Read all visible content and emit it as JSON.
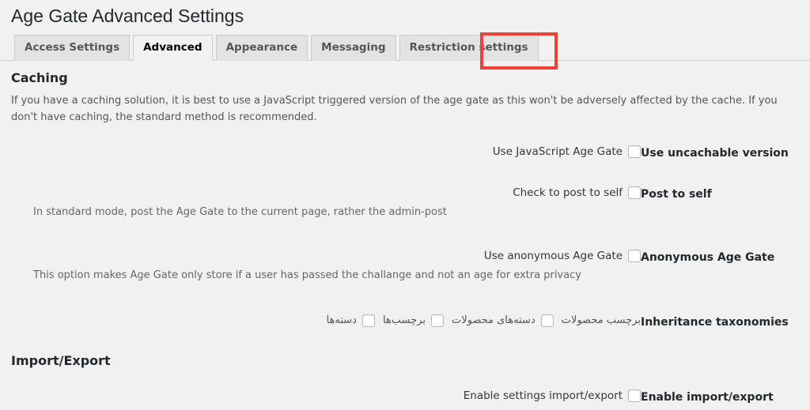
{
  "header": {
    "title": "Age Gate Advanced Settings"
  },
  "tabs": [
    {
      "label": "Access Settings",
      "name": "tab-access-settings",
      "active": false
    },
    {
      "label": "Advanced",
      "name": "tab-advanced",
      "active": true
    },
    {
      "label": "Appearance",
      "name": "tab-appearance",
      "active": false
    },
    {
      "label": "Messaging",
      "name": "tab-messaging",
      "active": false
    },
    {
      "label": "Restriction settings",
      "name": "tab-restriction-settings",
      "active": false
    }
  ],
  "highlight": {
    "color": "#ef4136",
    "target": "Advanced"
  },
  "sections": {
    "caching": {
      "heading": "Caching",
      "description": "If you have a caching solution, it is best to use a JavaScript triggered version of the age gate as this won't be adversely affected by the cache. If you don't have caching, the standard method is recommended."
    },
    "import_export": {
      "heading": "Import/Export"
    }
  },
  "rows": {
    "uncachable": {
      "label": "Use uncachable version",
      "checkbox_text": "Use JavaScript Age Gate",
      "checked": false
    },
    "post_to_self": {
      "label": "Post to self",
      "checkbox_text": "Check to post to self",
      "checked": false,
      "description": "In standard mode, post the Age Gate to the current page, rather the admin-post"
    },
    "anonymous": {
      "label": "Anonymous Age Gate",
      "checkbox_text": "Use anonymous Age Gate",
      "checked": false,
      "description": "This option makes Age Gate only store if a user has passed the challange and not an age for extra privacy"
    },
    "taxonomies": {
      "label": "Inheritance taxonomies",
      "items": [
        {
          "text": "دسته‌ها",
          "checked": false
        },
        {
          "text": "برچسب‌ها",
          "checked": false
        },
        {
          "text": "دسته‌های محصولات",
          "checked": false
        },
        {
          "text": "برچسب محصولات",
          "checked": false
        }
      ]
    },
    "import_export": {
      "label": "Enable import/export",
      "checkbox_text": "Enable settings import/export",
      "checked": false
    }
  },
  "colors": {
    "page_background": "#f1f1f1",
    "tab_inactive": "#e3e3e3",
    "tab_active": "#f1f1f1",
    "border": "#cccccc",
    "heading": "#23282d",
    "highlight": "#ef4136"
  }
}
